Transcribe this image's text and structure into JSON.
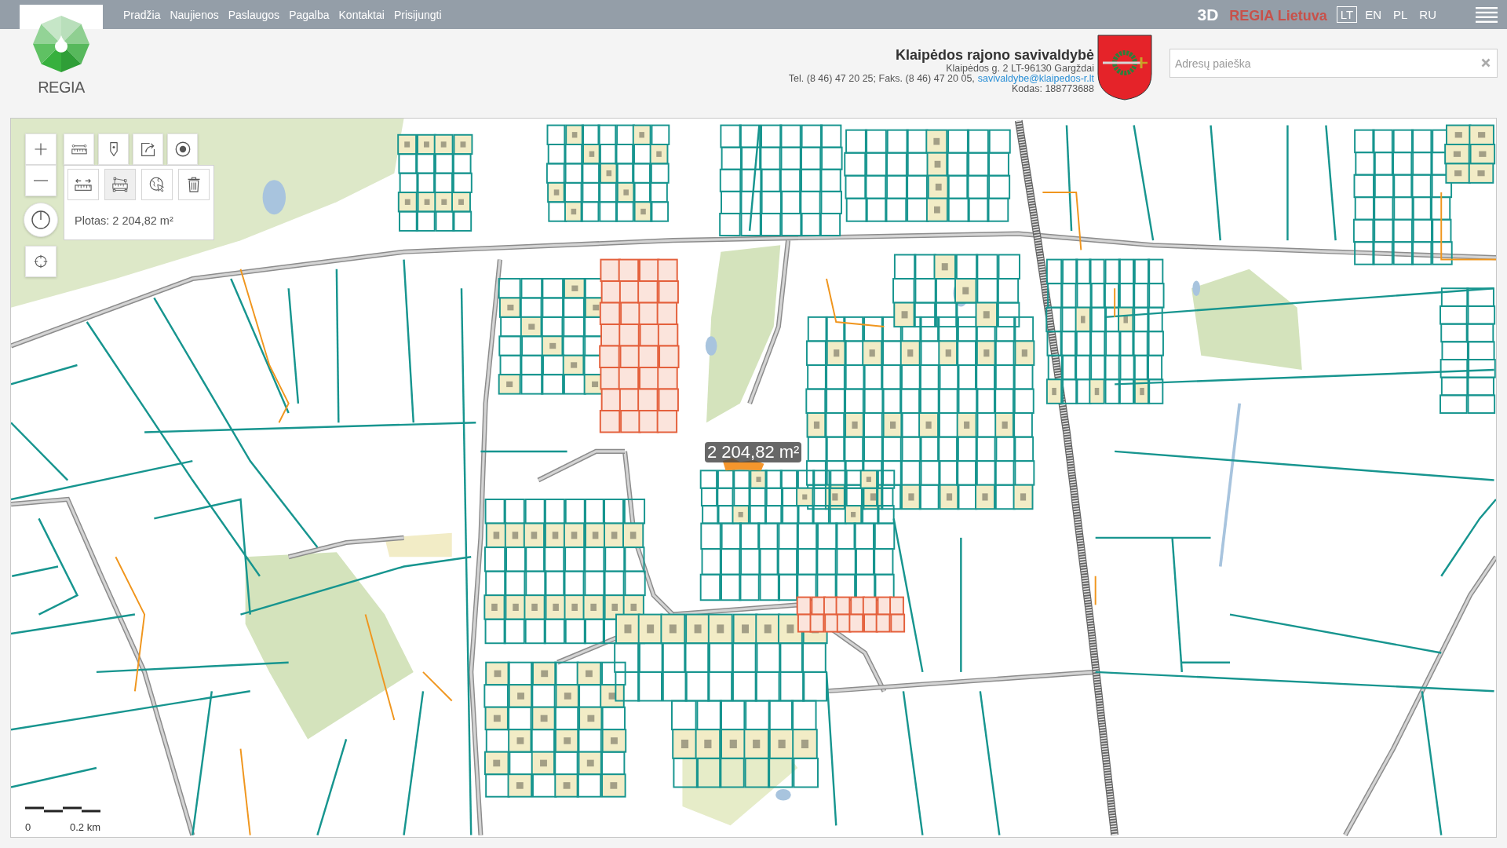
{
  "top_bar": {
    "nav": [
      "Pradžia",
      "Naujienos",
      "Paslaugos",
      "Pagalba",
      "Kontaktai",
      "Prisijungti"
    ],
    "view_3d": "3D",
    "brand": "REGIA Lietuva",
    "languages": [
      {
        "label": "LT",
        "selected": true
      },
      {
        "label": "EN",
        "selected": false
      },
      {
        "label": "PL",
        "selected": false
      },
      {
        "label": "RU",
        "selected": false
      }
    ]
  },
  "logo": {
    "text": "REGIA"
  },
  "municipality": {
    "name": "Klaipėdos rajono savivaldybė",
    "address": "Klaipėdos g. 2 LT-96130 Gargždai",
    "phone_fax": "Tel. (8 46) 47 20 25; Faks. (8 46) 47 20 05,",
    "email": "savivaldybe@klaipedos-r.lt",
    "code": "Kodas: 188773688"
  },
  "search": {
    "placeholder": "Adresų paieška"
  },
  "map": {
    "measure_tools": [
      {
        "selected": false
      },
      {
        "selected": true
      },
      {
        "selected": false
      },
      {
        "selected": false
      }
    ],
    "measure_result": "Plotas: 2 204,82 m²",
    "area_label": "2 204,82 m²",
    "scale_bar": {
      "start": "0",
      "end": "0.2 km"
    }
  }
}
